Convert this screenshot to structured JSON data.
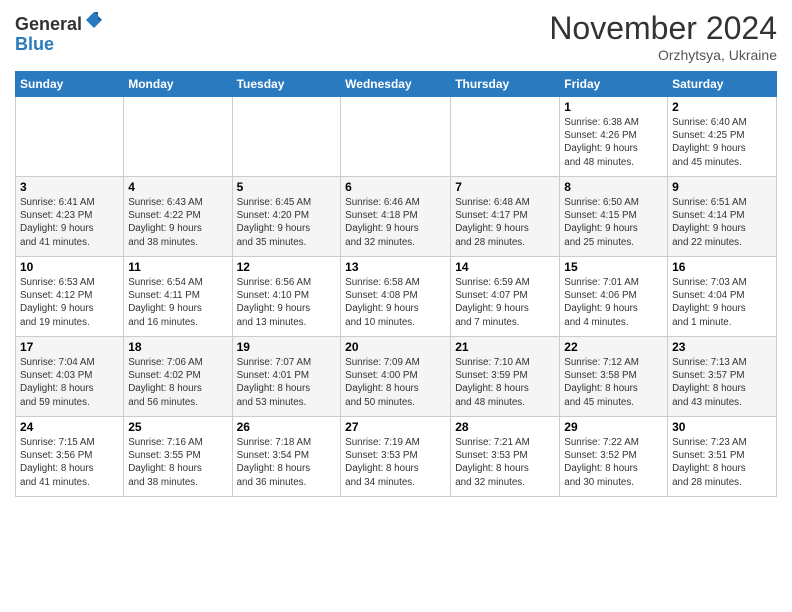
{
  "logo": {
    "general": "General",
    "blue": "Blue"
  },
  "header": {
    "month": "November 2024",
    "location": "Orzhytsya, Ukraine"
  },
  "weekdays": [
    "Sunday",
    "Monday",
    "Tuesday",
    "Wednesday",
    "Thursday",
    "Friday",
    "Saturday"
  ],
  "weeks": [
    [
      {
        "day": "",
        "info": ""
      },
      {
        "day": "",
        "info": ""
      },
      {
        "day": "",
        "info": ""
      },
      {
        "day": "",
        "info": ""
      },
      {
        "day": "",
        "info": ""
      },
      {
        "day": "1",
        "info": "Sunrise: 6:38 AM\nSunset: 4:26 PM\nDaylight: 9 hours\nand 48 minutes."
      },
      {
        "day": "2",
        "info": "Sunrise: 6:40 AM\nSunset: 4:25 PM\nDaylight: 9 hours\nand 45 minutes."
      }
    ],
    [
      {
        "day": "3",
        "info": "Sunrise: 6:41 AM\nSunset: 4:23 PM\nDaylight: 9 hours\nand 41 minutes."
      },
      {
        "day": "4",
        "info": "Sunrise: 6:43 AM\nSunset: 4:22 PM\nDaylight: 9 hours\nand 38 minutes."
      },
      {
        "day": "5",
        "info": "Sunrise: 6:45 AM\nSunset: 4:20 PM\nDaylight: 9 hours\nand 35 minutes."
      },
      {
        "day": "6",
        "info": "Sunrise: 6:46 AM\nSunset: 4:18 PM\nDaylight: 9 hours\nand 32 minutes."
      },
      {
        "day": "7",
        "info": "Sunrise: 6:48 AM\nSunset: 4:17 PM\nDaylight: 9 hours\nand 28 minutes."
      },
      {
        "day": "8",
        "info": "Sunrise: 6:50 AM\nSunset: 4:15 PM\nDaylight: 9 hours\nand 25 minutes."
      },
      {
        "day": "9",
        "info": "Sunrise: 6:51 AM\nSunset: 4:14 PM\nDaylight: 9 hours\nand 22 minutes."
      }
    ],
    [
      {
        "day": "10",
        "info": "Sunrise: 6:53 AM\nSunset: 4:12 PM\nDaylight: 9 hours\nand 19 minutes."
      },
      {
        "day": "11",
        "info": "Sunrise: 6:54 AM\nSunset: 4:11 PM\nDaylight: 9 hours\nand 16 minutes."
      },
      {
        "day": "12",
        "info": "Sunrise: 6:56 AM\nSunset: 4:10 PM\nDaylight: 9 hours\nand 13 minutes."
      },
      {
        "day": "13",
        "info": "Sunrise: 6:58 AM\nSunset: 4:08 PM\nDaylight: 9 hours\nand 10 minutes."
      },
      {
        "day": "14",
        "info": "Sunrise: 6:59 AM\nSunset: 4:07 PM\nDaylight: 9 hours\nand 7 minutes."
      },
      {
        "day": "15",
        "info": "Sunrise: 7:01 AM\nSunset: 4:06 PM\nDaylight: 9 hours\nand 4 minutes."
      },
      {
        "day": "16",
        "info": "Sunrise: 7:03 AM\nSunset: 4:04 PM\nDaylight: 9 hours\nand 1 minute."
      }
    ],
    [
      {
        "day": "17",
        "info": "Sunrise: 7:04 AM\nSunset: 4:03 PM\nDaylight: 8 hours\nand 59 minutes."
      },
      {
        "day": "18",
        "info": "Sunrise: 7:06 AM\nSunset: 4:02 PM\nDaylight: 8 hours\nand 56 minutes."
      },
      {
        "day": "19",
        "info": "Sunrise: 7:07 AM\nSunset: 4:01 PM\nDaylight: 8 hours\nand 53 minutes."
      },
      {
        "day": "20",
        "info": "Sunrise: 7:09 AM\nSunset: 4:00 PM\nDaylight: 8 hours\nand 50 minutes."
      },
      {
        "day": "21",
        "info": "Sunrise: 7:10 AM\nSunset: 3:59 PM\nDaylight: 8 hours\nand 48 minutes."
      },
      {
        "day": "22",
        "info": "Sunrise: 7:12 AM\nSunset: 3:58 PM\nDaylight: 8 hours\nand 45 minutes."
      },
      {
        "day": "23",
        "info": "Sunrise: 7:13 AM\nSunset: 3:57 PM\nDaylight: 8 hours\nand 43 minutes."
      }
    ],
    [
      {
        "day": "24",
        "info": "Sunrise: 7:15 AM\nSunset: 3:56 PM\nDaylight: 8 hours\nand 41 minutes."
      },
      {
        "day": "25",
        "info": "Sunrise: 7:16 AM\nSunset: 3:55 PM\nDaylight: 8 hours\nand 38 minutes."
      },
      {
        "day": "26",
        "info": "Sunrise: 7:18 AM\nSunset: 3:54 PM\nDaylight: 8 hours\nand 36 minutes."
      },
      {
        "day": "27",
        "info": "Sunrise: 7:19 AM\nSunset: 3:53 PM\nDaylight: 8 hours\nand 34 minutes."
      },
      {
        "day": "28",
        "info": "Sunrise: 7:21 AM\nSunset: 3:53 PM\nDaylight: 8 hours\nand 32 minutes."
      },
      {
        "day": "29",
        "info": "Sunrise: 7:22 AM\nSunset: 3:52 PM\nDaylight: 8 hours\nand 30 minutes."
      },
      {
        "day": "30",
        "info": "Sunrise: 7:23 AM\nSunset: 3:51 PM\nDaylight: 8 hours\nand 28 minutes."
      }
    ]
  ]
}
